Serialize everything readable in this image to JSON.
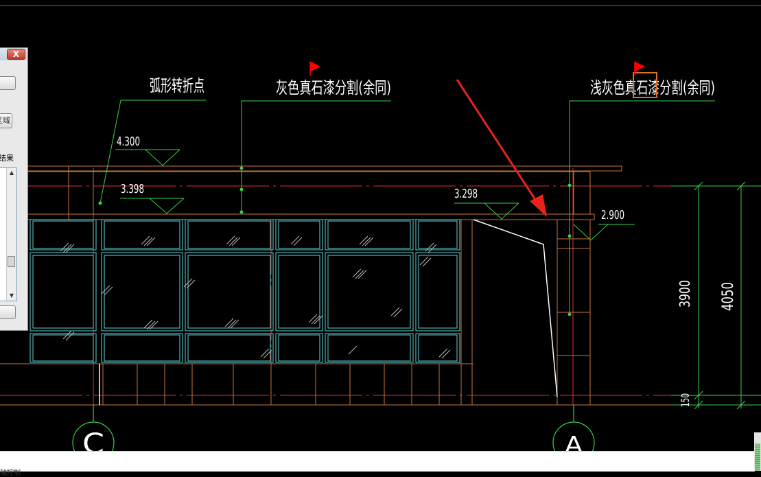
{
  "drawing": {
    "annotations": {
      "arc_turning_point": "弧形转折点",
      "gray_stone_paint": "灰色真石漆分割(余同)",
      "light_gray_stone_paint": "浅灰色真石漆分割(余同)"
    },
    "elevations": {
      "e1": "4.300",
      "e2": "3.398",
      "e3": "3.298",
      "e4": "2.900"
    },
    "dimensions": {
      "d1": "3900",
      "d2": "4050",
      "d3": "150"
    },
    "grid_labels": {
      "left": "C",
      "right": "A"
    }
  },
  "dialog": {
    "close_label": "X",
    "region_button_label": "区域",
    "result_label": "结果"
  },
  "status": {
    "text": "轴控制"
  },
  "colors": {
    "background": "#000000",
    "frame_orange": "#c8763a",
    "glass_cyan": "#5fd4d8",
    "axis_red": "#e03030",
    "leader_green": "#39d04a",
    "arrow_red": "#e8231e",
    "highlight_box": "#e07020"
  }
}
